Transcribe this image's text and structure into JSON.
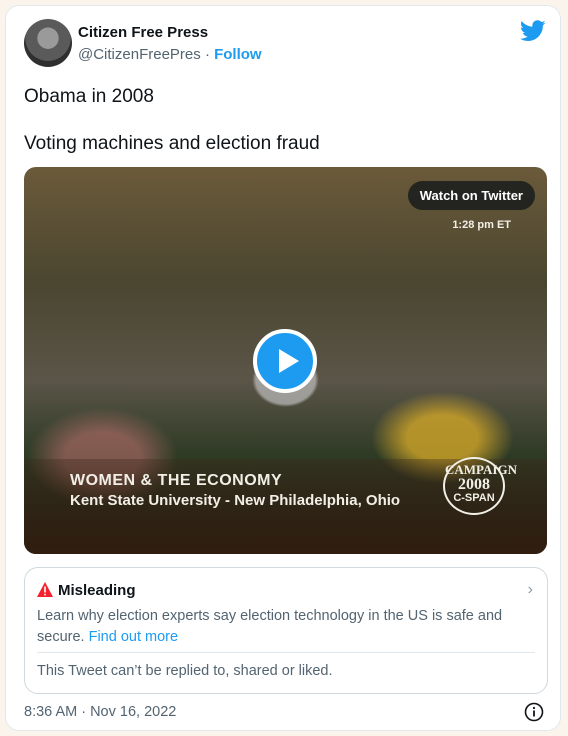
{
  "author": {
    "name": "Citizen Free Press",
    "handle": "@CitizenFreePres",
    "separator": "·",
    "follow_label": "Follow"
  },
  "tweet": {
    "line1": "Obama in 2008",
    "line2": "Voting machines and election fraud"
  },
  "video": {
    "watch_label": "Watch on Twitter",
    "time_badge": "1:28 pm ET",
    "caption_line1": "WOMEN & THE ECONOMY",
    "caption_line2": "Kent State University - New Philadelphia, Ohio",
    "logo_top": "CAMPAIGN",
    "logo_year": "2008",
    "logo_bottom": "C-SPAN"
  },
  "notice": {
    "title": "Misleading",
    "body": "Learn why election experts say election technology in the US is safe and secure.",
    "link": "Find out more",
    "restricted": "This Tweet can’t be replied to, shared or liked."
  },
  "footer": {
    "timestamp": "8:36 AM · Nov 16, 2022"
  },
  "colors": {
    "accent": "#1d9bf0",
    "warning": "#f4212e",
    "muted": "#536471",
    "background": "#fbf4ec"
  },
  "icons": [
    "twitter-bird-icon",
    "play-icon",
    "warning-icon",
    "chevron-right-icon",
    "info-icon"
  ]
}
